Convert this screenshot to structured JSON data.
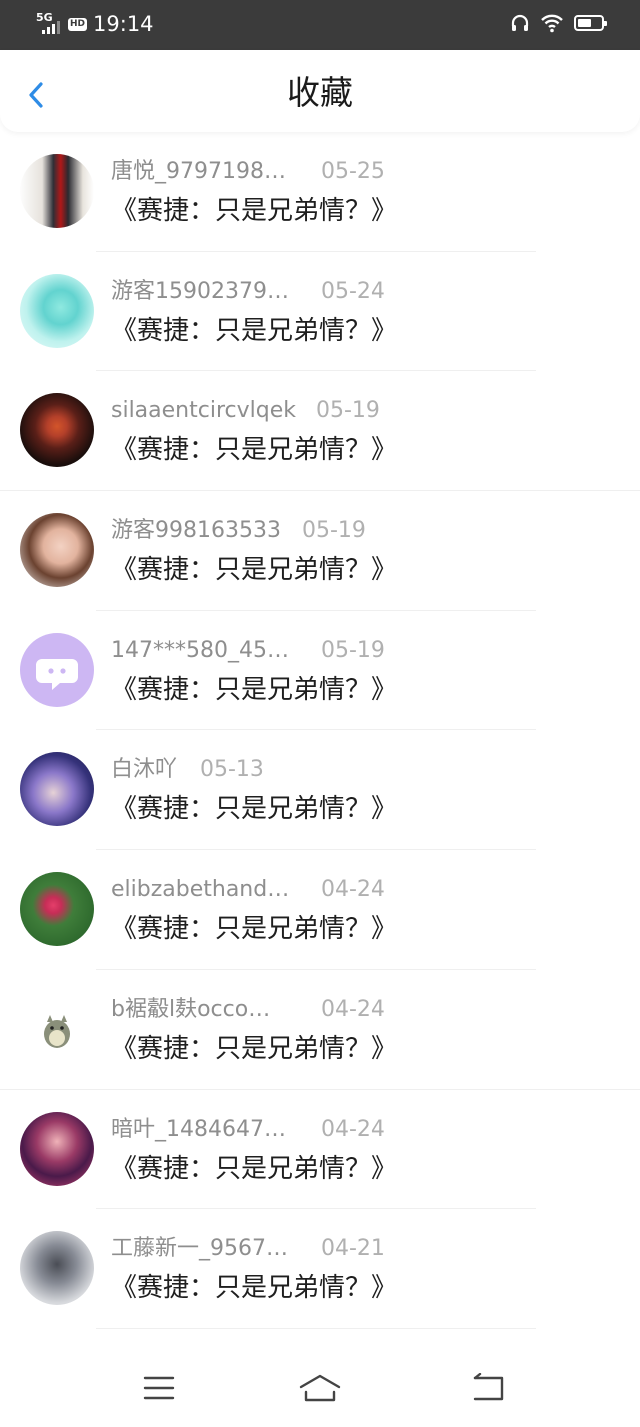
{
  "status_bar": {
    "network": "5G",
    "hd": "HD",
    "time": "19:14",
    "battery_level": 0.6,
    "icons": [
      "headphones-icon",
      "wifi-icon",
      "battery-icon"
    ]
  },
  "header": {
    "title": "收藏",
    "back_icon": "chevron-left-icon",
    "back_color": "#2e8ce6"
  },
  "items": [
    {
      "user": "唐悦_9797198…",
      "date": "05-25",
      "title": "《赛捷：只是兄弟情？》"
    },
    {
      "user": "游客15902379…",
      "date": "05-24",
      "title": "《赛捷：只是兄弟情？》"
    },
    {
      "user": "silaaentcircvlqek",
      "date": "05-19",
      "title": "《赛捷：只是兄弟情？》"
    },
    {
      "user": "游客998163533",
      "date": "05-19",
      "title": "《赛捷：只是兄弟情？》"
    },
    {
      "user": "147***580_45…",
      "date": "05-19",
      "title": "《赛捷：只是兄弟情？》"
    },
    {
      "user": "白沐吖",
      "date": "05-13",
      "title": "《赛捷：只是兄弟情？》"
    },
    {
      "user": "elibzabethand…",
      "date": "04-24",
      "title": "《赛捷：只是兄弟情？》"
    },
    {
      "user": "b裾觳l麸occo…",
      "date": "04-24",
      "title": "《赛捷：只是兄弟情？》"
    },
    {
      "user": "暗叶_1484647…",
      "date": "04-24",
      "title": "《赛捷：只是兄弟情？》"
    },
    {
      "user": "工藤新一_9567…",
      "date": "04-21",
      "title": "《赛捷：只是兄弟情？》"
    }
  ],
  "nav_bar": {
    "icons": [
      "menu-icon",
      "home-icon",
      "back-icon"
    ]
  }
}
